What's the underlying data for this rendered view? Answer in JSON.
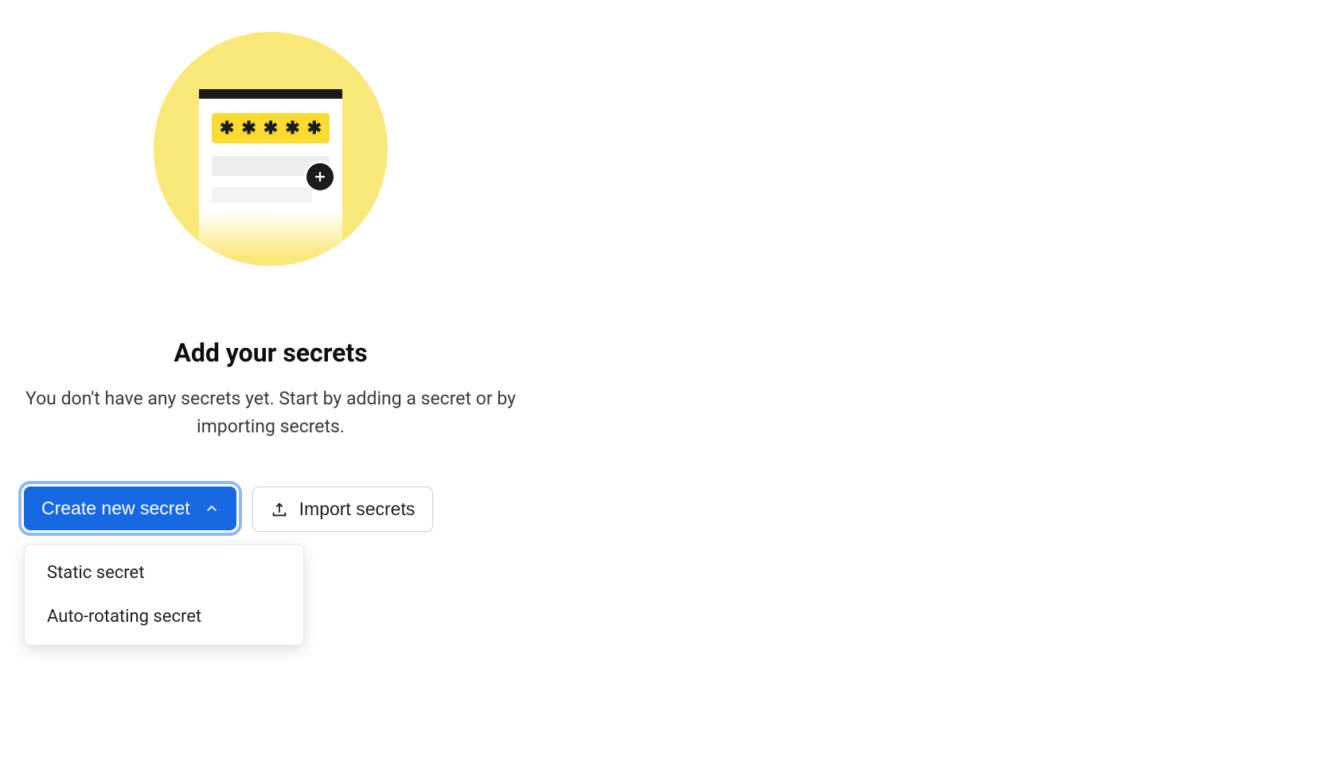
{
  "page": {
    "heading": "Add your secrets",
    "description": "You don't have any secrets yet. Start by adding a secret or by importing secrets."
  },
  "illustration": {
    "asterisks": [
      "✱",
      "✱",
      "✱",
      "✱",
      "✱"
    ]
  },
  "actions": {
    "create_label": "Create new secret",
    "import_label": "Import secrets"
  },
  "dropdown": {
    "items": [
      {
        "label": "Static secret"
      },
      {
        "label": "Auto-rotating secret"
      }
    ]
  }
}
